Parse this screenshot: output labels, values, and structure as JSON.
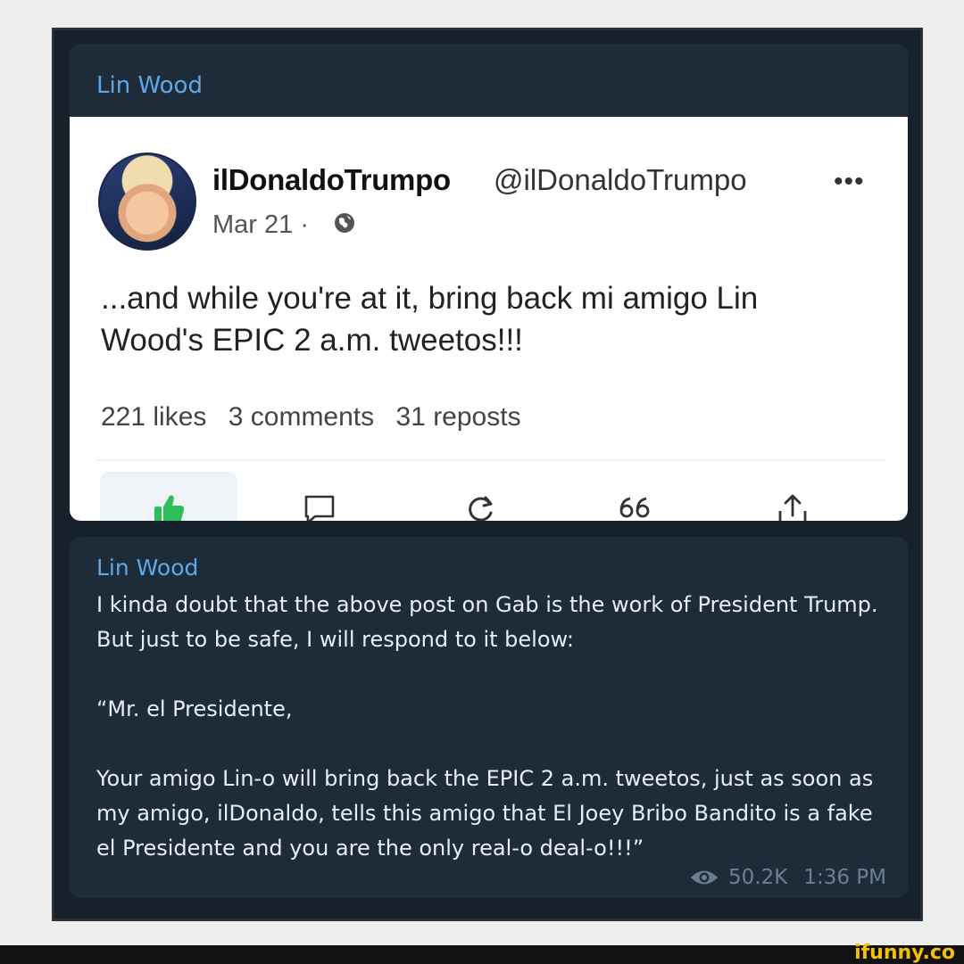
{
  "message1": {
    "sender": "Lin Wood",
    "post": {
      "author_name": "ilDonaldoTrumpo",
      "author_handle": "@ilDonaldoTrumpo",
      "date": "Mar 21 ·",
      "text": "...and while you're at it, bring back mi amigo Lin Wood's EPIC 2 a.m. tweetos!!!",
      "likes": "221 likes",
      "comments": "3 comments",
      "reposts": "31 reposts",
      "icons": [
        "avatar",
        "globe-icon",
        "more-icon",
        "thumbs-up-icon",
        "comment-icon",
        "repost-icon",
        "quote-icon",
        "share-icon"
      ],
      "like_active_color": "#2fbf5a"
    }
  },
  "message2": {
    "sender": "Lin Wood",
    "paragraph1": "I kinda doubt that the above post on Gab is the work of President Trump. But just to be safe, I will respond to it below:",
    "paragraph2": "“Mr. el Presidente,",
    "paragraph3": "Your amigo Lin-o will bring back the EPIC 2 a.m. tweetos, just as soon as my amigo, ilDonaldo, tells this amigo that El Joey Bribo Bandito is a fake el Presidente and you are the only real-o deal-o!!!”",
    "views": "50.2K",
    "time": "1:36 PM"
  },
  "watermark": "ifunny.co"
}
